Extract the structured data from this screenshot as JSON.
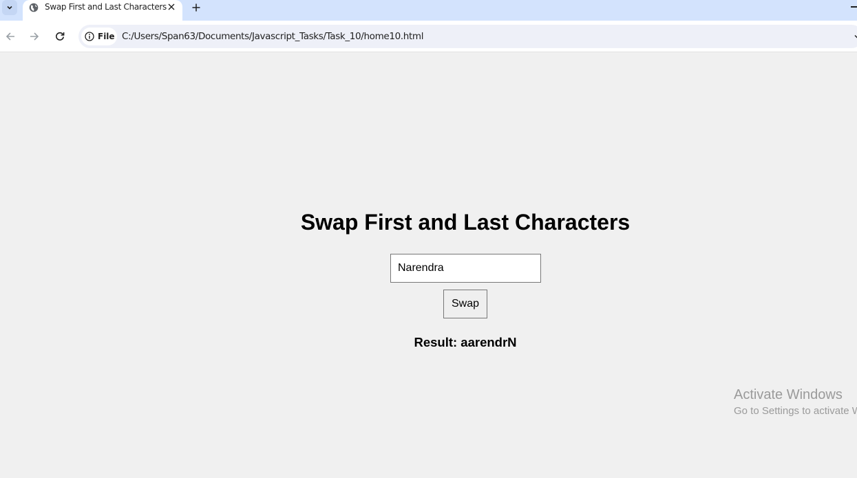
{
  "browser": {
    "tab": {
      "title": "Swap First and Last Characters"
    },
    "omnibox": {
      "chip_label": "File",
      "url": "C:/Users/Span63/Documents/Javascript_Tasks/Task_10/home10.html"
    }
  },
  "page": {
    "heading": "Swap First and Last Characters",
    "input_value": "Narendra",
    "button_label": "Swap",
    "result_text": "Result: aarendrN"
  },
  "watermark": {
    "line1": "Activate Windows",
    "line2": "Go to Settings to activate Windows."
  },
  "colors": {
    "tabstrip": "#d3e3fd",
    "page_bg": "#f0f0f0",
    "omnibox_bg": "#eef0f8"
  }
}
